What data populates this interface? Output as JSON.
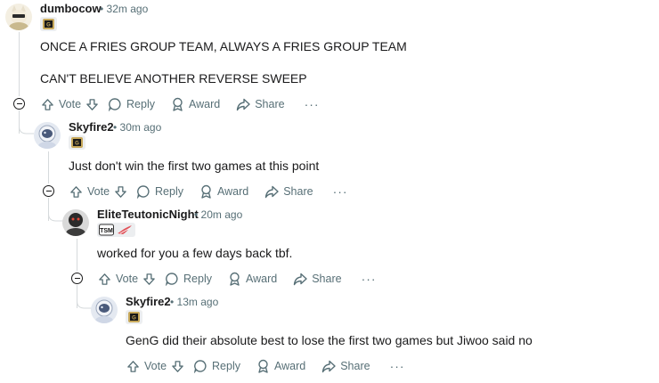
{
  "comments": [
    {
      "user": "dumbocow",
      "time": "32m ago",
      "lines": [
        "ONCE A FRIES GROUP TEAM, ALWAYS A FRIES GROUP TEAM",
        "CAN'T BELIEVE ANOTHER REVERSE SWEEP"
      ],
      "flair": "geng-flair",
      "avatar": "fox-avatar"
    },
    {
      "user": "Skyfire2",
      "time": "30m ago",
      "lines": [
        "Just don't win the first two games at this point"
      ],
      "flair": "geng-flair",
      "avatar": "astronaut-avatar"
    },
    {
      "user": "EliteTeutonicNight",
      "time": "20m ago",
      "lines": [
        "worked for you a few days back tbf."
      ],
      "flair": "tsm-flair",
      "avatar": "dark-avatar"
    },
    {
      "user": "Skyfire2",
      "time": "13m ago",
      "lines": [
        "GenG did their absolute best to lose the first two games but Jiwoo said no"
      ],
      "flair": "geng-flair",
      "avatar": "astronaut-avatar"
    }
  ],
  "actions": {
    "vote": "Vote",
    "reply": "Reply",
    "award": "Award",
    "share": "Share",
    "more": "···"
  },
  "separator": "•",
  "colors": {
    "text": "#1a1a1b",
    "meta": "#576f76",
    "thread": "#d6dadc"
  }
}
